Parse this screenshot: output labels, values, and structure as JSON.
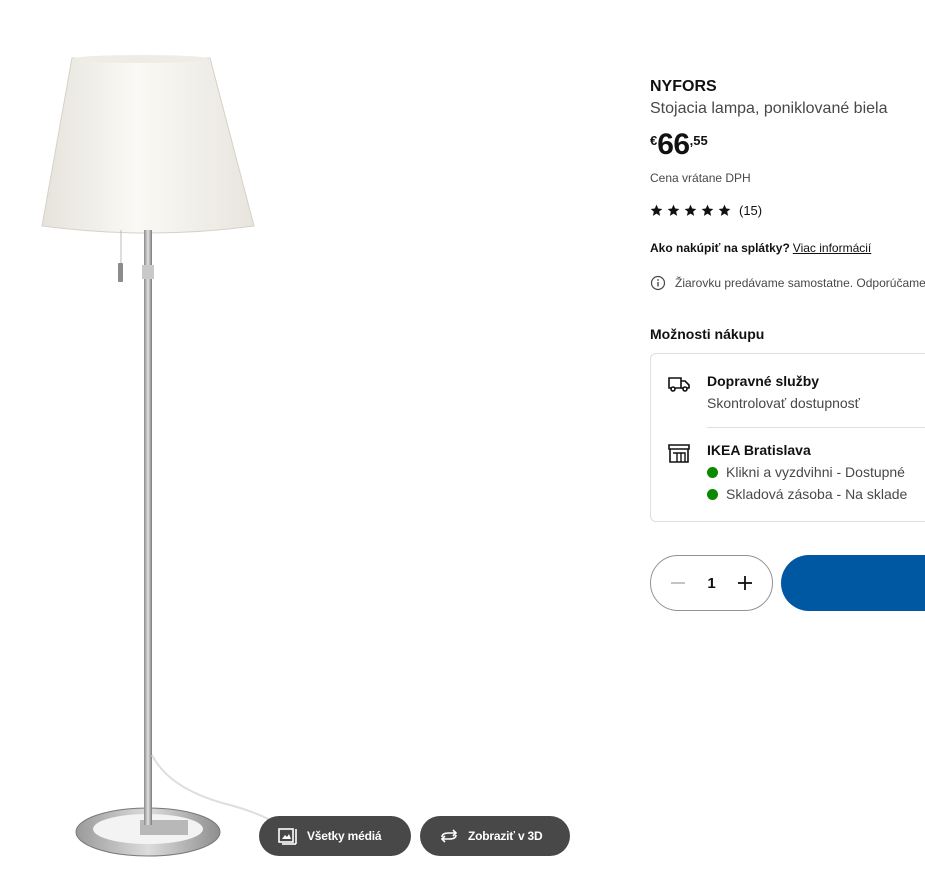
{
  "product": {
    "name": "NYFORS",
    "description": "Stojacia lampa, poniklované biela",
    "price": {
      "currency": "€",
      "integer": "66",
      "decimal": ",55"
    },
    "vat_note": "Cena vrátane DPH",
    "rating": {
      "stars": 5,
      "count": "(15)"
    },
    "installments": {
      "question": "Ako nakúpiť na splátky?",
      "link": "Viac informácií"
    },
    "bulb_note": "Žiarovku predávame samostatne. Odporúčame"
  },
  "media": {
    "all_media_label": "Všetky médiá",
    "view_3d_label": "Zobraziť v 3D"
  },
  "purchase_options": {
    "heading": "Možnosti nákupu",
    "delivery": {
      "title": "Dopravné služby",
      "subtitle": "Skontrolovať dostupnosť"
    },
    "store": {
      "title": "IKEA Bratislava",
      "click_collect": "Klikni a vyzdvihni - Dostupné",
      "stock": "Skladová zásoba - Na sklade"
    },
    "status_color": "#0a8a00"
  },
  "quantity": {
    "value": "1"
  },
  "colors": {
    "accent": "#0058a3",
    "dark_button": "#484848"
  }
}
